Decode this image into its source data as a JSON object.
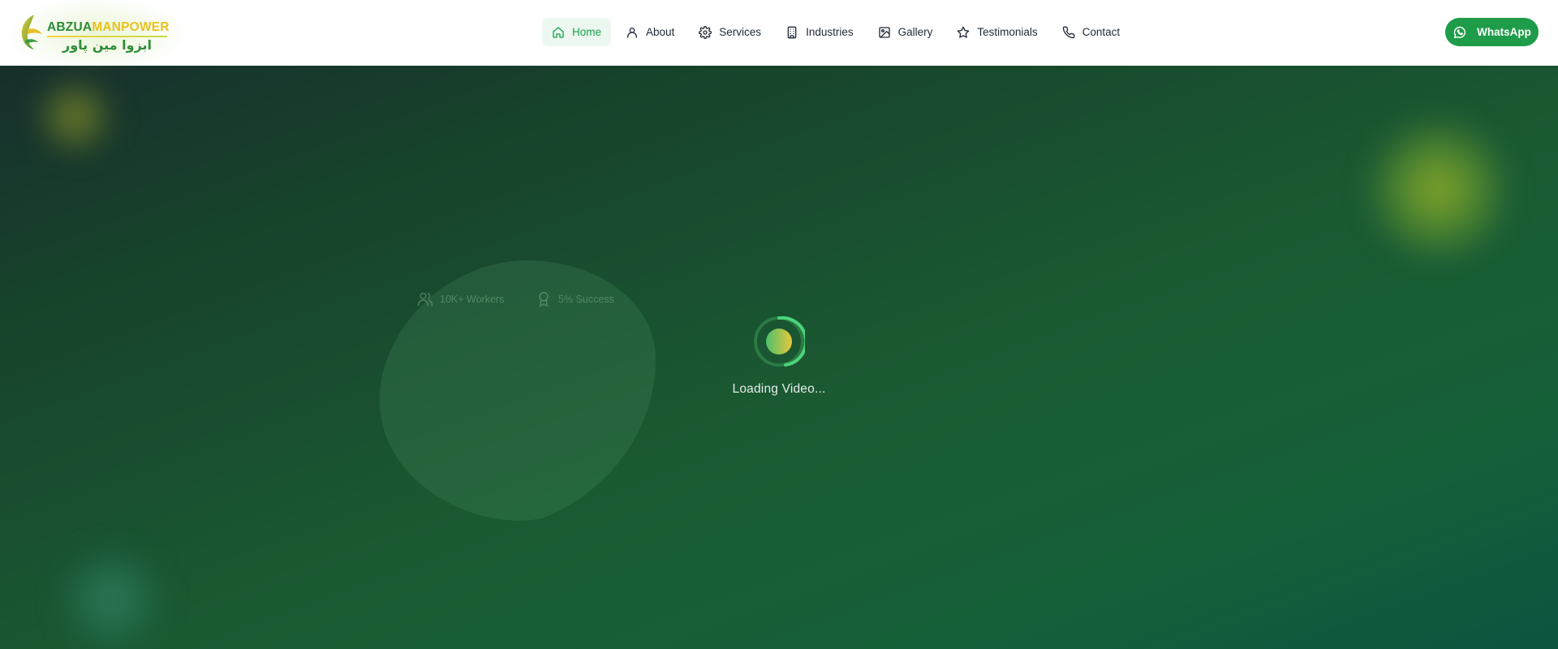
{
  "brand": {
    "name_part1": "ABZUA",
    "name_part2": "MANPOWER",
    "urdu_name": "ابزوا مین پاور",
    "logo_icon": "leaf-swirl-logo-icon"
  },
  "nav": {
    "items": [
      {
        "label": "Home",
        "icon": "home-icon",
        "active": true
      },
      {
        "label": "About",
        "icon": "user-icon",
        "active": false
      },
      {
        "label": "Services",
        "icon": "gear-icon",
        "active": false
      },
      {
        "label": "Industries",
        "icon": "building-icon",
        "active": false
      },
      {
        "label": "Gallery",
        "icon": "image-icon",
        "active": false
      },
      {
        "label": "Testimonials",
        "icon": "star-icon",
        "active": false
      },
      {
        "label": "Contact",
        "icon": "phone-icon",
        "active": false
      }
    ]
  },
  "cta": {
    "whatsapp_label": "WhatsApp",
    "icon": "whatsapp-icon"
  },
  "hero": {
    "stats": [
      {
        "label": "10K+ Workers",
        "icon": "users-icon"
      },
      {
        "label": "5% Success",
        "icon": "award-icon"
      }
    ],
    "loading_text": "Loading Video..."
  },
  "colors": {
    "accent_green": "#16a34a",
    "active_nav_bg": "#ecf7ef",
    "whatsapp_green": "#1e9c49",
    "hero_dark": "#17432b",
    "brand_yellow": "#e8c21b"
  }
}
